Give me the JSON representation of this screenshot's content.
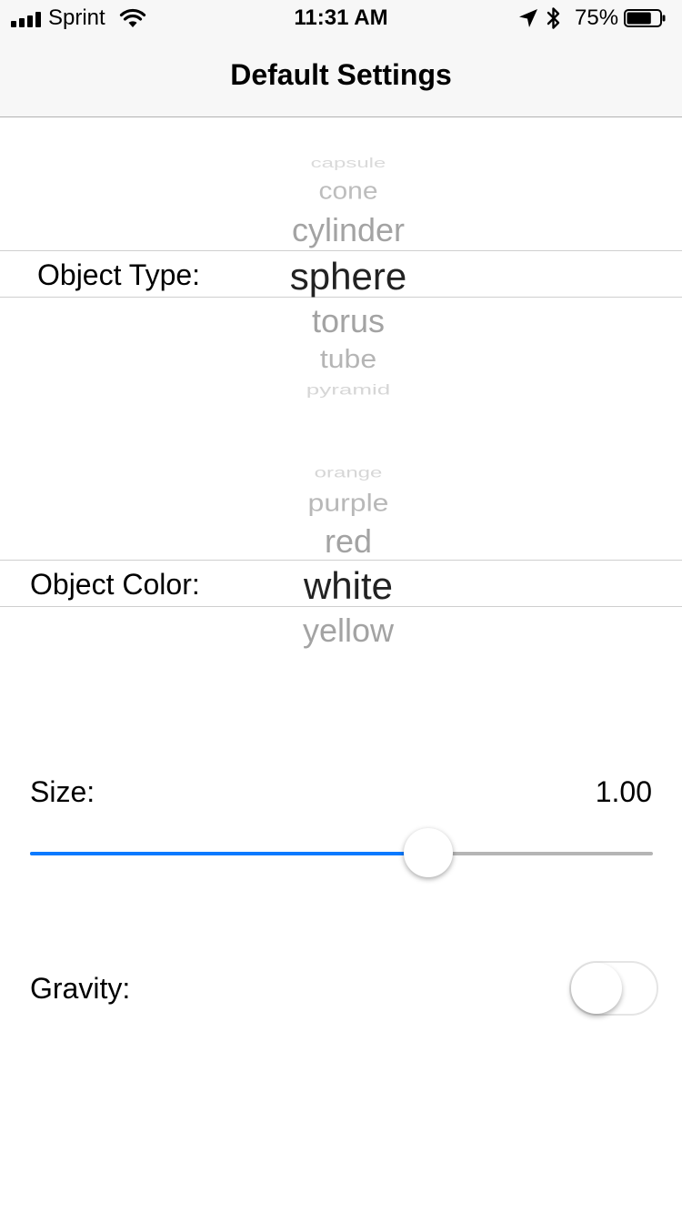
{
  "status_bar": {
    "carrier": "Sprint",
    "time": "11:31 AM",
    "battery_percent": "75%",
    "battery_level": 0.75,
    "signal_bars_filled": 4,
    "icons": [
      "signal-icon",
      "wifi-icon",
      "location-arrow-icon",
      "bluetooth-icon",
      "battery-icon"
    ]
  },
  "nav": {
    "title": "Default Settings"
  },
  "object_type": {
    "label": "Object Type:",
    "options": [
      "capsule",
      "cone",
      "cylinder",
      "sphere",
      "torus",
      "tube",
      "pyramid"
    ],
    "selected": "sphere"
  },
  "object_color": {
    "label": "Object Color:",
    "options": [
      "orange",
      "purple",
      "red",
      "white",
      "yellow"
    ],
    "selected": "white"
  },
  "size": {
    "label": "Size:",
    "value": "1.00",
    "slider_fraction": 0.64,
    "accent_color": "#0a7aff"
  },
  "gravity": {
    "label": "Gravity:",
    "enabled": false
  }
}
